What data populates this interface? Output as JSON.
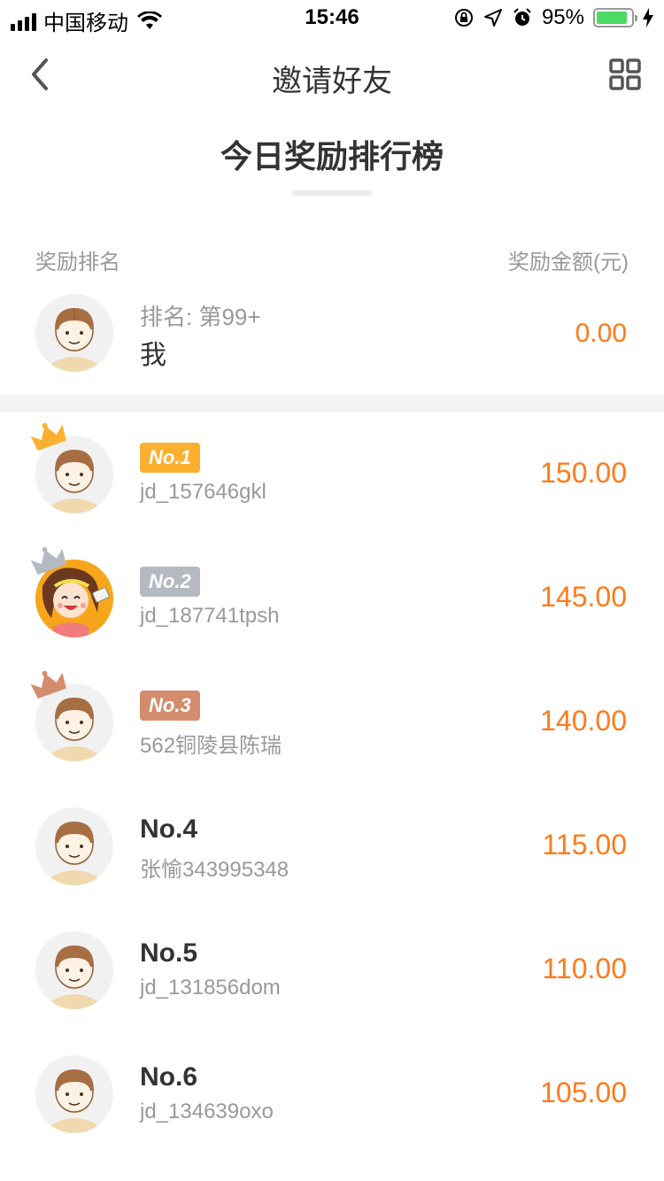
{
  "status_bar": {
    "carrier": "中国移动",
    "time": "15:46",
    "battery_percent": "95%",
    "battery_level": 0.95,
    "icons": [
      "signal-icon",
      "wifi-icon",
      "orientation-lock-icon",
      "location-arrow-icon",
      "alarm-icon",
      "battery-icon",
      "charging-icon"
    ]
  },
  "nav": {
    "title": "邀请好友",
    "back_icon": "chevron-left-icon",
    "qr_icon": "qr-grid-icon"
  },
  "board": {
    "title": "今日奖励排行榜",
    "col_rank": "奖励排名",
    "col_amount": "奖励金额(元)"
  },
  "me": {
    "rank_label": "排名: 第99+",
    "name": "我",
    "amount": "0.00"
  },
  "leaderboard": [
    {
      "badge": "No.1",
      "user": "jd_157646gkl",
      "amount": "150.00"
    },
    {
      "badge": "No.2",
      "user": "jd_187741tpsh",
      "amount": "145.00"
    },
    {
      "badge": "No.3",
      "user": "562铜陵县陈瑞",
      "amount": "140.00"
    },
    {
      "badge": "No.4",
      "user": "张愉343995348",
      "amount": "115.00"
    },
    {
      "badge": "No.5",
      "user": "jd_131856dom",
      "amount": "110.00"
    },
    {
      "badge": "No.6",
      "user": "jd_134639oxo",
      "amount": "105.00"
    }
  ],
  "colors": {
    "amount": "#ff7a1a",
    "gold": "#fbb02f",
    "silver": "#b5b9c2",
    "bronze": "#d38c6c"
  }
}
